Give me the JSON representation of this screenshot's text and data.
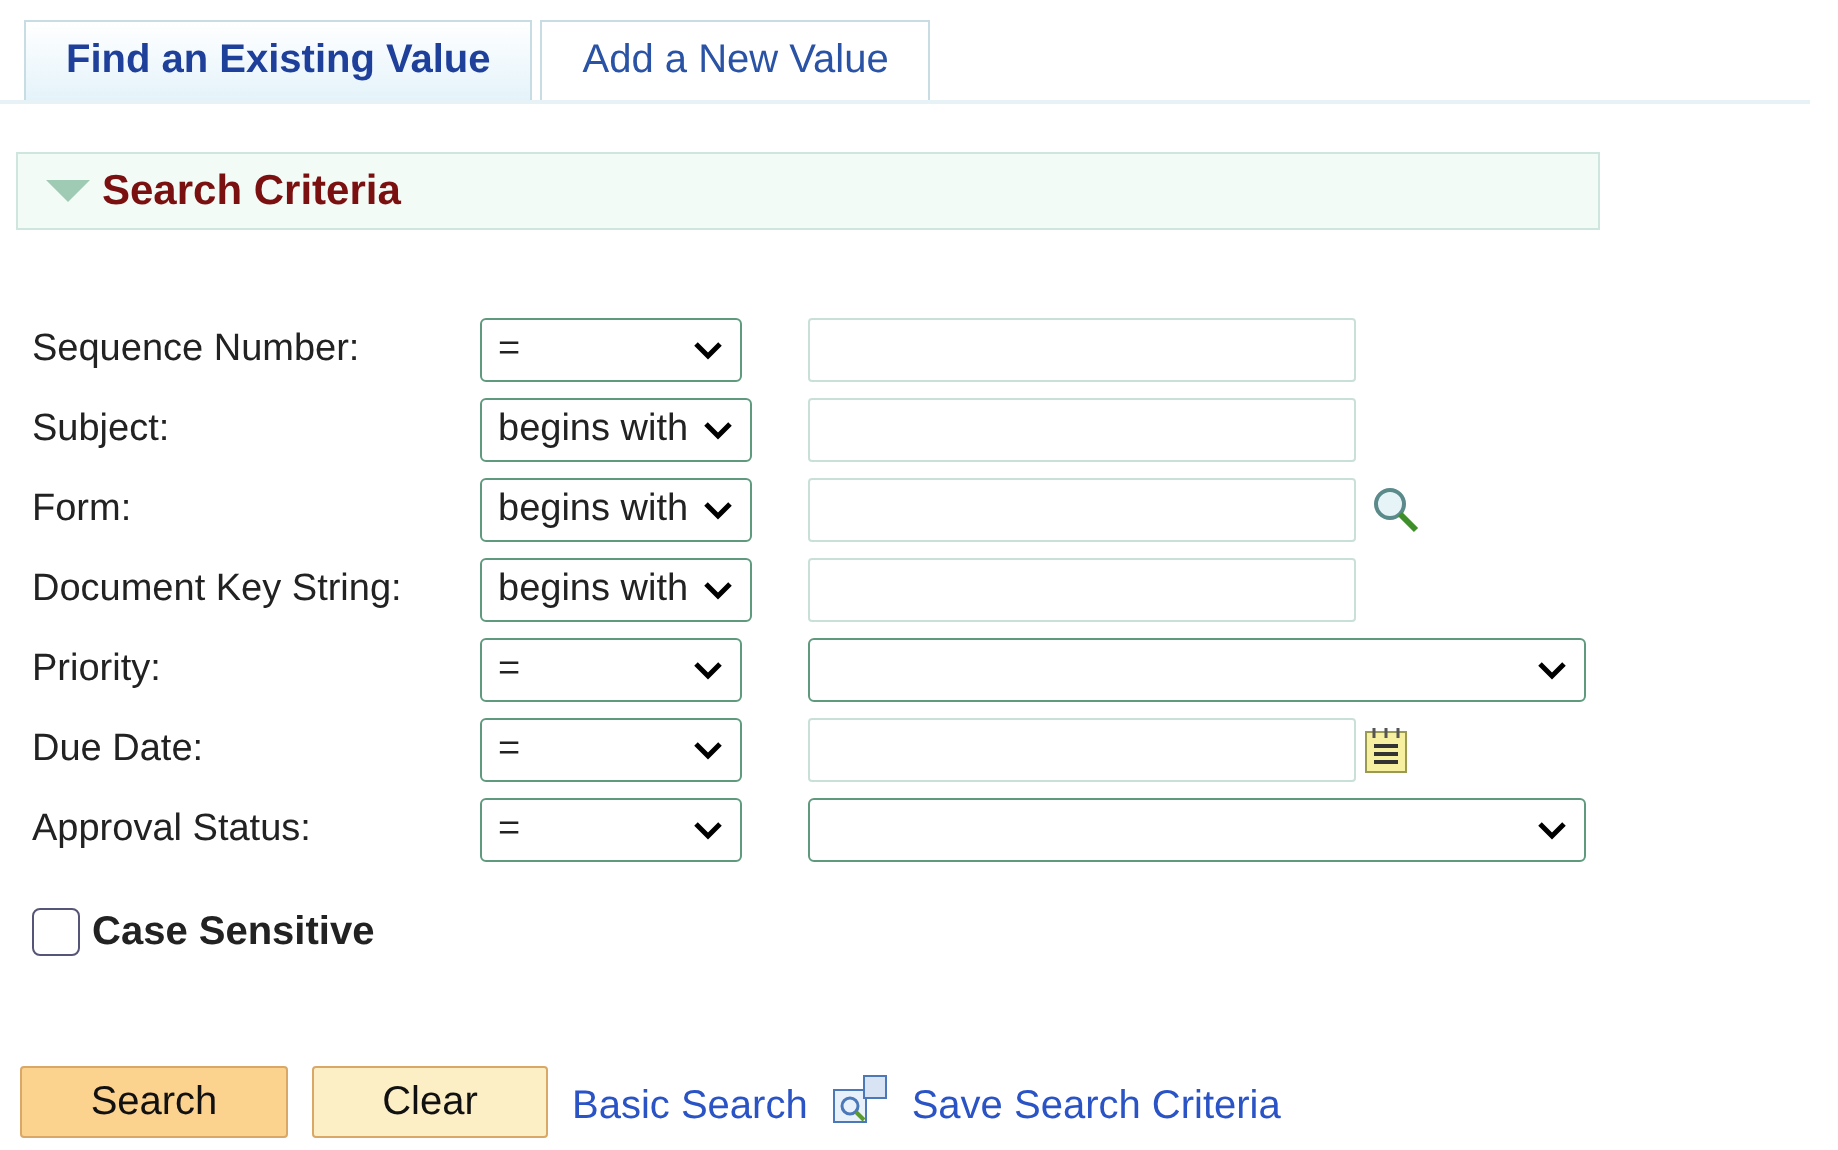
{
  "tabs": [
    {
      "label": "Find an Existing Value",
      "selected": true
    },
    {
      "label": "Add a New Value",
      "selected": false
    }
  ],
  "section": {
    "title": "Search Criteria",
    "expanded": true
  },
  "fields": [
    {
      "label": "Sequence Number:",
      "operator": "=",
      "kind": "text"
    },
    {
      "label": "Subject:",
      "operator": "begins with",
      "kind": "text"
    },
    {
      "label": "Form:",
      "operator": "begins with",
      "kind": "lookup"
    },
    {
      "label": "Document Key String:",
      "operator": "begins with",
      "kind": "text"
    },
    {
      "label": "Priority:",
      "operator": "=",
      "kind": "select"
    },
    {
      "label": "Due Date:",
      "operator": "=",
      "kind": "date"
    },
    {
      "label": "Approval Status:",
      "operator": "=",
      "kind": "select"
    }
  ],
  "case_sensitive": {
    "label": "Case Sensitive",
    "checked": false
  },
  "actions": [
    {
      "label": "Search",
      "kind": "primary"
    },
    {
      "label": "Clear",
      "kind": "secondary"
    },
    {
      "label": "Basic Search",
      "kind": "link"
    },
    {
      "label": "Save Search Criteria",
      "kind": "save-link"
    }
  ]
}
